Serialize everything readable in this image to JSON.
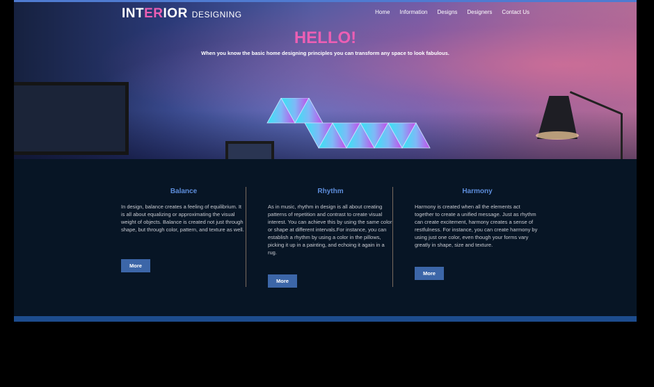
{
  "header": {
    "logo_main_parts": [
      "INT",
      "ER",
      "IOR"
    ],
    "logo_sub": "DESIGNING",
    "nav": [
      "Home",
      "Information",
      "Designs",
      "Designers",
      "Contact Us"
    ]
  },
  "hero": {
    "title": "HELLO!",
    "tagline": "When you know the basic home designing principles you can transform any space to look fabulous."
  },
  "features": [
    {
      "title": "Balance",
      "text": "In design, balance creates a feeling of equilibrium. It is all about equalizing or approximating the visual weight of objects. Balance is created not just through shape, but through color, pattern, and texture as well.",
      "button": "More"
    },
    {
      "title": "Rhythm",
      "text": "As in music, rhythm in design is all about creating patterns of repetition and contrast to create visual interest. You can achieve this by using the same color or shape at different intervals.For instance, you can establish a rhythm by using a color in the pillows, picking it up in a painting, and echoing it again in a rug.",
      "button": "More"
    },
    {
      "title": "Harmony",
      "text": "Harmony is created when all the elements act together to create a unified message. Just as rhythm can create excitement, harmony creates a sense of restfulness. For instance, you can create harmony by using just one color, even though your forms vary greatly in shape, size and texture.",
      "button": "More"
    }
  ],
  "colors": {
    "accent_pink": "#ec5fb4",
    "heading_blue": "#5d8ddb",
    "button_blue": "#3c66a8",
    "bottom_bar": "#1d4c8d",
    "dark_bg": "#071525"
  },
  "icons": {
    "panels": "hexagon-light-panels"
  }
}
